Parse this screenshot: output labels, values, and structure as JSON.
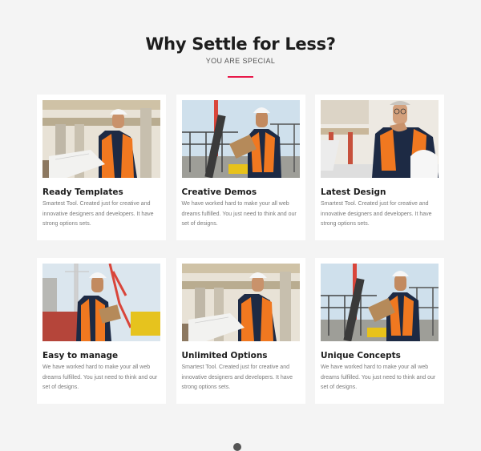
{
  "section": {
    "title": "Why Settle for Less?",
    "subtitle": "YOU ARE SPECIAL",
    "accent_color": "#e8194a"
  },
  "cards": [
    {
      "title": "Ready Templates",
      "text": "Smartest Tool. Created just for creative and innovative designers and developers. It have strong options sets.",
      "image": "worker-blueprint"
    },
    {
      "title": "Creative Demos",
      "text": "We have worked hard to make your all web dreams fulfilled. You just need to think and our set of designs.",
      "image": "worker-clipboard"
    },
    {
      "title": "Latest Design",
      "text": "Smartest Tool. Created just for creative and innovative designers and developers. It have strong options sets.",
      "image": "worker-thinking-laptop"
    },
    {
      "title": "Easy to manage",
      "text": "We have worked hard to make your all web dreams fulfilled. You just need to think and our set of designs.",
      "image": "worker-crane-clipboard"
    },
    {
      "title": "Unlimited Options",
      "text": "Smartest Tool. Created just for creative and innovative designers and developers. It have strong options sets.",
      "image": "worker-blueprint"
    },
    {
      "title": "Unique Concepts",
      "text": "We have worked hard to make your all web dreams fulfilled. You just need to think and our set of designs.",
      "image": "worker-clipboard"
    }
  ]
}
